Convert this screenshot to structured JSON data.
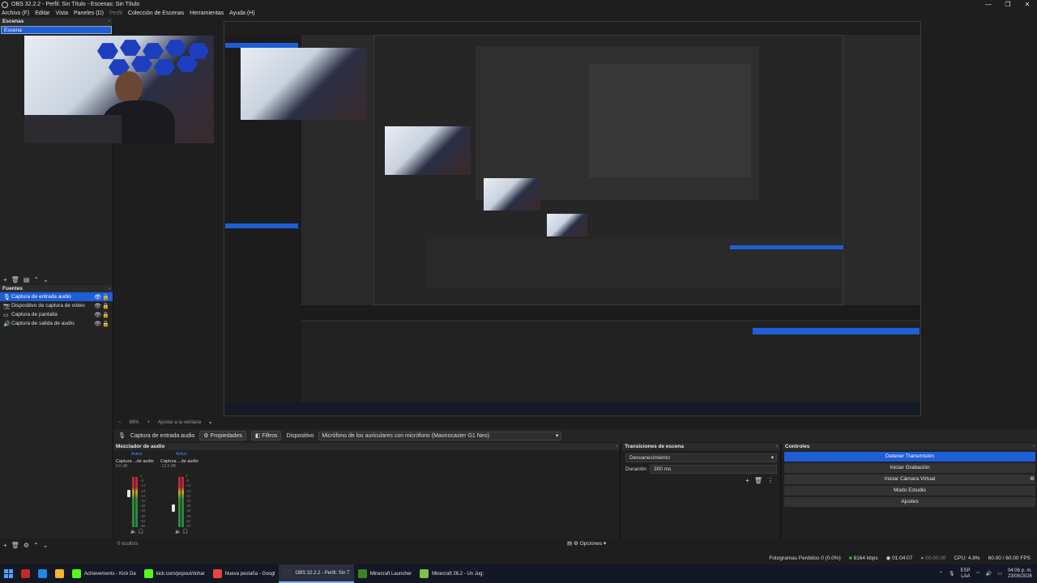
{
  "window": {
    "title": "OBS 32.2.2 - Perfil: Sin Título - Escenas: Sin Título",
    "controls": [
      "—",
      "❐",
      "✕"
    ]
  },
  "menu": [
    "Archivo (F)",
    "Editar",
    "Vista",
    "Paneles (D)",
    "Perfil",
    "Colección de Escenas",
    "Herramientas",
    "Ayuda (H)"
  ],
  "scenes": {
    "title": "Escenas",
    "items": [
      "Escena"
    ]
  },
  "sources": {
    "title": "Fuentes",
    "items": [
      {
        "label": "Captura de entrada audio",
        "icon": "microphone-icon"
      },
      {
        "label": "Dispositivo de captura de vídeo",
        "icon": "camera-icon"
      },
      {
        "label": "Captura de pantalla",
        "icon": "monitor-icon"
      },
      {
        "label": "Captura de salida de audio",
        "icon": "speaker-icon"
      }
    ],
    "hidden_count": "0 oculto/s"
  },
  "zoombar": {
    "zoom": "69%",
    "fit": "Ajustar a la ventana"
  },
  "properties_bar": {
    "source_name": "Captura de entrada audio",
    "properties": "Propiedades",
    "filters": "Filtros",
    "device_label": "Dispositivo",
    "device_value": "Micrófono de los auriculares con micrófono (Maonocaster G1 Neo)"
  },
  "mixer": {
    "title": "Mezclador de audio",
    "channels": [
      {
        "name": "Captura ...de audio",
        "db": "0.0 dB",
        "status": "Activo",
        "level": 0.75
      },
      {
        "name": "Captura ...de audio",
        "db": "-12.0 dB",
        "status": "Activo",
        "level": 0.45
      }
    ],
    "scale": [
      "0",
      "-6",
      "-12",
      "-18",
      "-24",
      "-30",
      "-36",
      "-42",
      "-48",
      "-54",
      "-60"
    ],
    "options": "Opciones"
  },
  "transitions": {
    "title": "Transiciones de escena",
    "type": "Desvanecimiento",
    "duration_label": "Duración",
    "duration_value": "300 ms"
  },
  "controls": {
    "title": "Controles",
    "buttons": [
      "Detener Transmisión",
      "Iniciar Grabación",
      "Iniciar Cámara Virtual",
      "Modo Estudio",
      "Ajustes"
    ]
  },
  "status": {
    "dropped": "Fotogramas Perdidos 0 (0.0%)",
    "kbps": "8164 kbps",
    "live_time": "01:04:07",
    "rec_time": "00:00:00",
    "cpu": "CPU: 4.8%",
    "fps": "60.00 / 60.00 FPS"
  },
  "taskbar": {
    "items": [
      {
        "label": "Achievements - Kick Da",
        "color": "#53fc18"
      },
      {
        "label": "kick.com/popout/richar",
        "color": "#53fc18"
      },
      {
        "label": "Nueva pestaña - Googl",
        "color": "#e8453c"
      },
      {
        "label": "OBS 32.2.2 - Perfil: Sin T",
        "color": "#333333",
        "active": true
      },
      {
        "label": "Minecraft Launcher",
        "color": "#3c8527"
      },
      {
        "label": "Minecraft 26.2 - Un Jug:",
        "color": "#7fbf4a"
      }
    ],
    "lang": "ESP",
    "lang2": "LAA",
    "time": "04:06 p. m.",
    "date": "23/08/2026"
  }
}
